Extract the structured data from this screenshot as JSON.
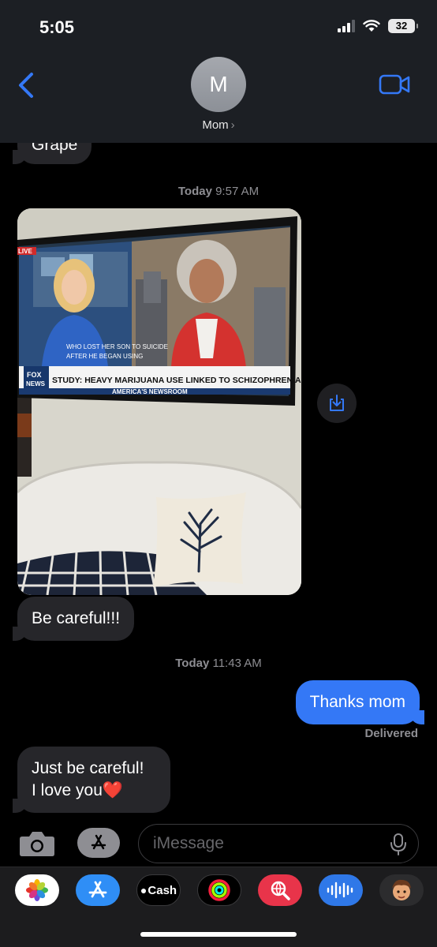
{
  "status_bar": {
    "time": "5:05",
    "battery": "32"
  },
  "header": {
    "avatar_initial": "M",
    "contact_name": "Mom",
    "chevron": "›"
  },
  "messages": {
    "grape": "Grape",
    "timestamp1": {
      "day": "Today",
      "time": "9:57 AM"
    },
    "photo": {
      "live_label": "LIVE",
      "chyron_small_1": "WHO LOST HER SON TO SUICIDE",
      "chyron_small_2": "AFTER HE BEGAN USING",
      "headline": "STUDY: HEAVY MARIJUANA USE LINKED TO SCHIZOPHRENIA",
      "network_1": "FOX",
      "network_2": "NEWS",
      "program": "AMERICA'S NEWSROOM"
    },
    "be_careful": "Be careful!!!",
    "timestamp2": {
      "day": "Today",
      "time": "11:43 AM"
    },
    "thanks": "Thanks mom",
    "delivered": "Delivered",
    "just_be_careful_1": "Just be careful!",
    "just_be_careful_2": "I love you",
    "heart": "❤️"
  },
  "input": {
    "placeholder": "iMessage"
  },
  "drawer": {
    "cash_label": "Cash"
  },
  "colors": {
    "accent_blue": "#3478f6",
    "incoming_bubble": "#26262a",
    "header_bg": "#1c1f24"
  }
}
